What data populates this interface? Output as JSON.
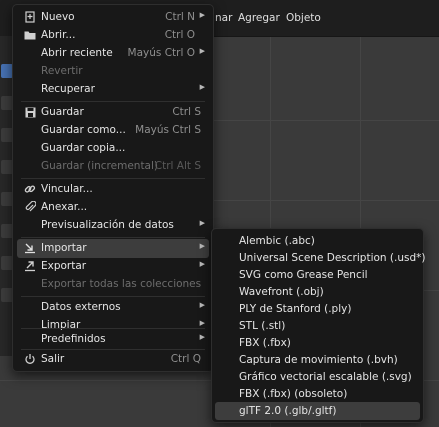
{
  "header": {
    "menus": [
      "nar",
      "Agregar",
      "Objeto"
    ]
  },
  "file_menu": {
    "items": [
      {
        "label": "Nuevo",
        "shortcut": "Ctrl N",
        "arrow": true,
        "icon": "new-file-icon",
        "disabled": false
      },
      {
        "label": "Abrir...",
        "shortcut": "Ctrl O",
        "arrow": false,
        "icon": "folder-icon",
        "disabled": false
      },
      {
        "label": "Abrir reciente",
        "shortcut": "Mayús Ctrl O",
        "arrow": true,
        "icon": "",
        "disabled": false
      },
      {
        "label": "Revertir",
        "shortcut": "",
        "arrow": false,
        "icon": "",
        "disabled": true
      },
      {
        "label": "Recuperar",
        "shortcut": "",
        "arrow": true,
        "icon": "",
        "disabled": false
      },
      {
        "label": "Guardar",
        "shortcut": "Ctrl S",
        "arrow": false,
        "icon": "save-icon",
        "disabled": false
      },
      {
        "label": "Guardar como...",
        "shortcut": "Mayús Ctrl S",
        "arrow": false,
        "icon": "",
        "disabled": false
      },
      {
        "label": "Guardar copia...",
        "shortcut": "",
        "arrow": false,
        "icon": "",
        "disabled": false
      },
      {
        "label": "Guardar (incremental)",
        "shortcut": "Ctrl Alt S",
        "arrow": false,
        "icon": "",
        "disabled": true
      },
      {
        "label": "Vincular...",
        "shortcut": "",
        "arrow": false,
        "icon": "link-icon",
        "disabled": false
      },
      {
        "label": "Anexar...",
        "shortcut": "",
        "arrow": false,
        "icon": "paperclip-icon",
        "disabled": false
      },
      {
        "label": "Previsualización de datos",
        "shortcut": "",
        "arrow": true,
        "icon": "",
        "disabled": false
      },
      {
        "label": "Importar",
        "shortcut": "",
        "arrow": true,
        "icon": "import-icon",
        "disabled": false,
        "highlighted": true
      },
      {
        "label": "Exportar",
        "shortcut": "",
        "arrow": true,
        "icon": "export-icon",
        "disabled": false
      },
      {
        "label": "Exportar todas las colecciones",
        "shortcut": "",
        "arrow": false,
        "icon": "",
        "disabled": true
      },
      {
        "label": "Datos externos",
        "shortcut": "",
        "arrow": true,
        "icon": "",
        "disabled": false
      },
      {
        "label": "Limpiar",
        "shortcut": "",
        "arrow": true,
        "icon": "",
        "disabled": false
      },
      {
        "label": "Predefinidos",
        "shortcut": "",
        "arrow": true,
        "icon": "",
        "disabled": false
      },
      {
        "label": "Salir",
        "shortcut": "Ctrl Q",
        "arrow": false,
        "icon": "power-icon",
        "disabled": false
      }
    ]
  },
  "import_submenu": {
    "items": [
      "Alembic (.abc)",
      "Universal Scene Description (.usd*)",
      "SVG como Grease Pencil",
      "Wavefront (.obj)",
      "PLY de Stanford (.ply)",
      "STL (.stl)",
      "FBX (.fbx)",
      "Captura de movimiento (.bvh)",
      "Gráfico vectorial escalable (.svg)",
      "FBX (.fbx) (obsoleto)",
      "glTF 2.0 (.glb/.gltf)"
    ],
    "highlighted_index": 10
  },
  "colors": {
    "menu_bg": "#181818",
    "highlight": "#3d3d3d",
    "accent": "#4772b3"
  }
}
